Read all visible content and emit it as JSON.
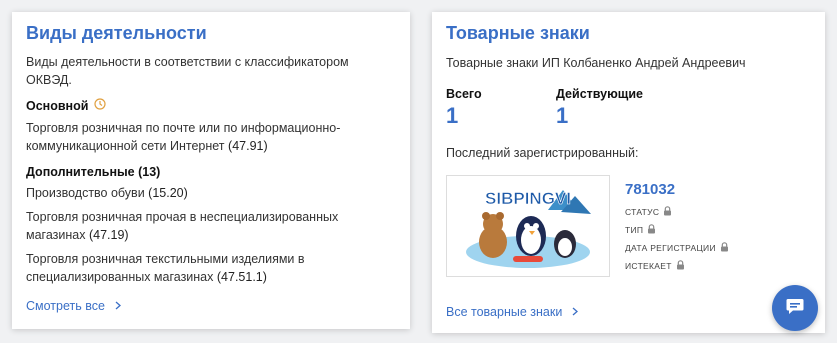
{
  "activities": {
    "title": "Виды деятельности",
    "description": "Виды деятельности в соответствии с классификатором ОКВЭД.",
    "main_heading": "Основной",
    "main_item": {
      "text": "Торговля розничная по почте или по информационно-коммуникационной сети Интернет",
      "code": "(47.91)"
    },
    "additional_heading": "Дополнительные (13)",
    "additional_items": [
      {
        "text": "Производство обуви",
        "code": "(15.20)"
      },
      {
        "text": "Торговля розничная прочая в неспециализированных магазинах",
        "code": "(47.19)"
      },
      {
        "text": "Торговля розничная текстильными изделиями в специализированных магазинах",
        "code": "(47.51.1)"
      }
    ],
    "more_link": "Смотреть все"
  },
  "trademarks": {
    "title": "Товарные знаки",
    "owner": "Товарные знаки ИП Колбаненко Андрей Андреевич",
    "total_label": "Всего",
    "total_value": "1",
    "active_label": "Действующие",
    "active_value": "1",
    "last_label": "Последний зарегистрированный:",
    "last": {
      "logo_text": "SIBPINGVI",
      "number": "781032",
      "attrs": [
        "СТАТУС",
        "ТИП",
        "ДАТА РЕГИСТРАЦИИ",
        "ИСТЕКАЕТ"
      ]
    },
    "more_link": "Все товарные знаки"
  },
  "colors": {
    "accent": "#3a6fc6",
    "clock": "#e0a040"
  }
}
